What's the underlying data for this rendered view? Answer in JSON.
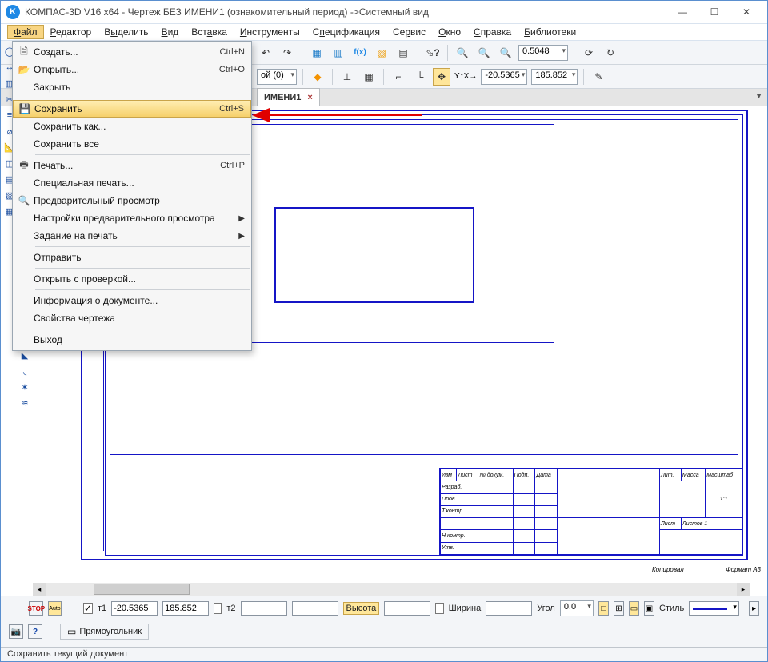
{
  "title": "КОМПАС-3D V16  x64 - Чертеж БЕЗ ИМЕНИ1 (ознакомительный период) ->Системный вид",
  "menu": {
    "file": {
      "label": "Файл",
      "hot": "Ф"
    },
    "edit": {
      "label": "Редактор",
      "hot": "Р"
    },
    "select": {
      "label": "Выделить",
      "hot": "ы"
    },
    "view": {
      "label": "Вид",
      "hot": "В"
    },
    "insert": {
      "label": "Вставка",
      "hot": "а"
    },
    "tools": {
      "label": "Инструменты",
      "hot": "И"
    },
    "spec": {
      "label": "Спецификация",
      "hot": "п"
    },
    "service": {
      "label": "Сервис",
      "hot": "р"
    },
    "window": {
      "label": "Окно",
      "hot": "О"
    },
    "help": {
      "label": "Справка",
      "hot": "С"
    },
    "libs": {
      "label": "Библиотеки",
      "hot": "Б"
    }
  },
  "file_menu": {
    "new": {
      "label": "Создать...",
      "shortcut": "Ctrl+N"
    },
    "open": {
      "label": "Открыть...",
      "shortcut": "Ctrl+O"
    },
    "close": {
      "label": "Закрыть",
      "shortcut": ""
    },
    "save": {
      "label": "Сохранить",
      "shortcut": "Ctrl+S"
    },
    "saveas": {
      "label": "Сохранить как...",
      "shortcut": ""
    },
    "saveall": {
      "label": "Сохранить все",
      "shortcut": ""
    },
    "print": {
      "label": "Печать...",
      "shortcut": "Ctrl+P"
    },
    "specprint": {
      "label": "Специальная печать...",
      "shortcut": ""
    },
    "preview": {
      "label": "Предварительный просмотр",
      "shortcut": ""
    },
    "previewcfg": {
      "label": "Настройки предварительного просмотра",
      "shortcut": ""
    },
    "printjob": {
      "label": "Задание на печать",
      "shortcut": ""
    },
    "send": {
      "label": "Отправить",
      "shortcut": ""
    },
    "openchk": {
      "label": "Открыть с проверкой...",
      "shortcut": ""
    },
    "docinfo": {
      "label": "Информация о документе...",
      "shortcut": ""
    },
    "drawprops": {
      "label": "Свойства чертежа",
      "shortcut": ""
    },
    "exit": {
      "label": "Выход",
      "shortcut": ""
    }
  },
  "toolbar1": {
    "zoom_value": "0.5048"
  },
  "toolbar2": {
    "layer_value": "ой (0)",
    "x_value": "-20.5365",
    "y_value": "185.852"
  },
  "doc_tab": {
    "label": "ИМЕНИ1",
    "close": "×"
  },
  "prop_bar": {
    "t1_label": "т1",
    "t1_x": "-20.5365",
    "t1_y": "185.852",
    "t2_label": "т2",
    "height_label": "Высота",
    "width_label": "Ширина",
    "angle_label": "Угол",
    "angle_value": "0.0",
    "style_label": "Стиль",
    "tool_label": "Прямоугольник"
  },
  "status": {
    "text": "Сохранить текущий документ"
  },
  "titleblock": {
    "r1c1": "Изм",
    "r1c2": "Лист",
    "r1c3": "№ докум.",
    "r1c4": "Подп.",
    "r1c5": "Дата",
    "r2": "Разраб.",
    "r3": "Пров.",
    "r4": "Т.контр.",
    "r5": "Н.контр.",
    "r6": "Утв.",
    "tc_lit": "Лит.",
    "tc_mass": "Масса",
    "tc_scale": "Масштаб",
    "tc_scalev": "1:1",
    "tc_sheet": "Лист",
    "tc_sheets": "Листов   1",
    "foot_cp": "Копировал",
    "foot_fmt": "Формат   А3"
  }
}
